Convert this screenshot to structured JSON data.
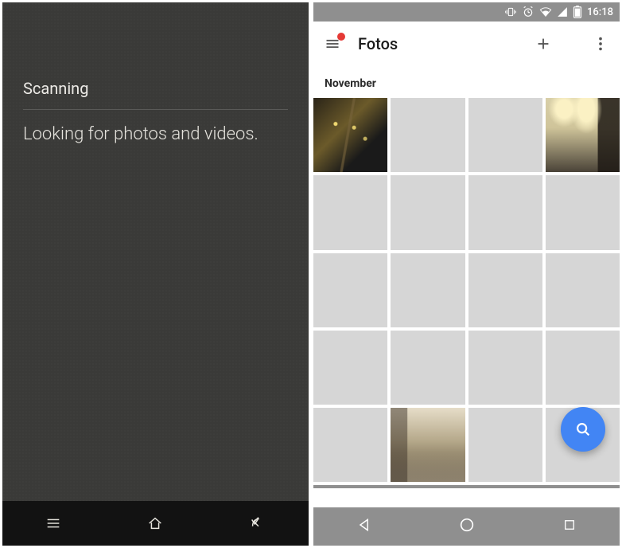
{
  "left": {
    "heading": "Scanning",
    "subtext": "Looking for photos and videos."
  },
  "right": {
    "statusbar": {
      "time": "16:18"
    },
    "appbar": {
      "title": "Fotos"
    },
    "section": {
      "label": "November"
    },
    "grid": {
      "cells": [
        {
          "type": "photo",
          "variant": "p0"
        },
        {
          "type": "blank"
        },
        {
          "type": "blank"
        },
        {
          "type": "photo",
          "variant": "p3"
        },
        {
          "type": "blank"
        },
        {
          "type": "blank"
        },
        {
          "type": "blank"
        },
        {
          "type": "blank"
        },
        {
          "type": "blank"
        },
        {
          "type": "blank"
        },
        {
          "type": "blank"
        },
        {
          "type": "blank"
        },
        {
          "type": "blank"
        },
        {
          "type": "blank"
        },
        {
          "type": "blank"
        },
        {
          "type": "blank"
        },
        {
          "type": "blank"
        },
        {
          "type": "photo",
          "variant": "p17"
        },
        {
          "type": "blank"
        },
        {
          "type": "blank"
        }
      ]
    }
  },
  "icons": {
    "menu": "menu-icon",
    "plus": "plus-icon",
    "more": "more-vert-icon",
    "search": "search-icon",
    "vibrate": "vibrate-icon",
    "alarm": "alarm-icon",
    "wifi": "wifi-icon",
    "cell": "cell-icon",
    "battery": "battery-icon",
    "back_tri": "back-triangle-icon",
    "home_circle": "home-circle-icon",
    "recent_sq": "recent-square-icon",
    "hamburger": "hamburger-icon",
    "home_outline": "home-outline-icon",
    "back_arrow": "back-arrow-icon"
  }
}
